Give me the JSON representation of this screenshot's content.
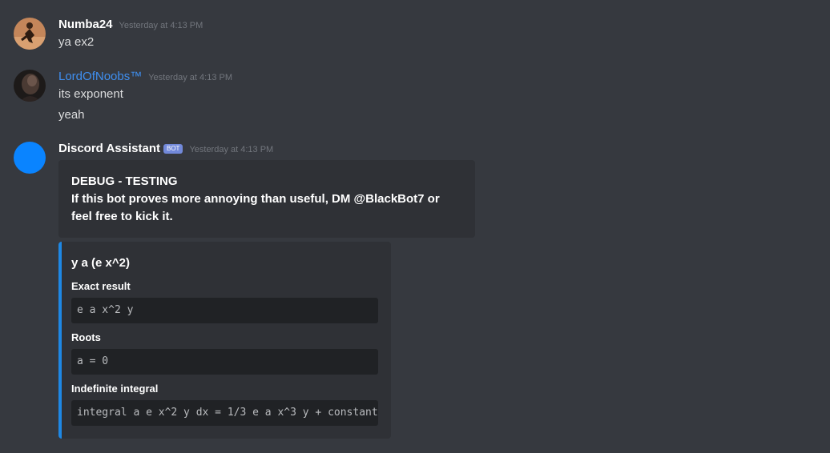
{
  "messages": [
    {
      "username": "Numba24",
      "timestamp": "Yesterday at 4:13 PM",
      "lines": [
        "ya ex2"
      ]
    },
    {
      "username": "LordOfNoobs™",
      "timestamp": "Yesterday at 4:13 PM",
      "lines": [
        "its exponent",
        "yeah"
      ]
    },
    {
      "username": "Discord Assistant",
      "bot_tag": "BOT",
      "timestamp": "Yesterday at 4:13 PM",
      "debug_embed": {
        "title": "DEBUG - TESTING",
        "description": "If this bot proves more annoying than useful, DM @BlackBot7 or feel free to kick it."
      },
      "math_embed": {
        "title": "y a (e x^2)",
        "fields": [
          {
            "name": "Exact result",
            "value": "e a x^2 y"
          },
          {
            "name": "Roots",
            "value": "a = 0"
          },
          {
            "name": "Indefinite integral",
            "value": "integral a e x^2 y dx = 1/3 e a x^3 y + constant"
          }
        ]
      }
    }
  ],
  "colors": {
    "background": "#36393f",
    "embed_background": "#2f3136",
    "code_background": "#202225",
    "embed_accent": "#1e88e5",
    "link_username": "#3f8ff0",
    "bot_tag": "#7289da",
    "bot_avatar": "#0a84ff"
  },
  "icons": {
    "numba24_avatar": "user-avatar-icon",
    "lordofnoobs_avatar": "user-avatar-icon",
    "bot_avatar": "bot-avatar-icon"
  }
}
